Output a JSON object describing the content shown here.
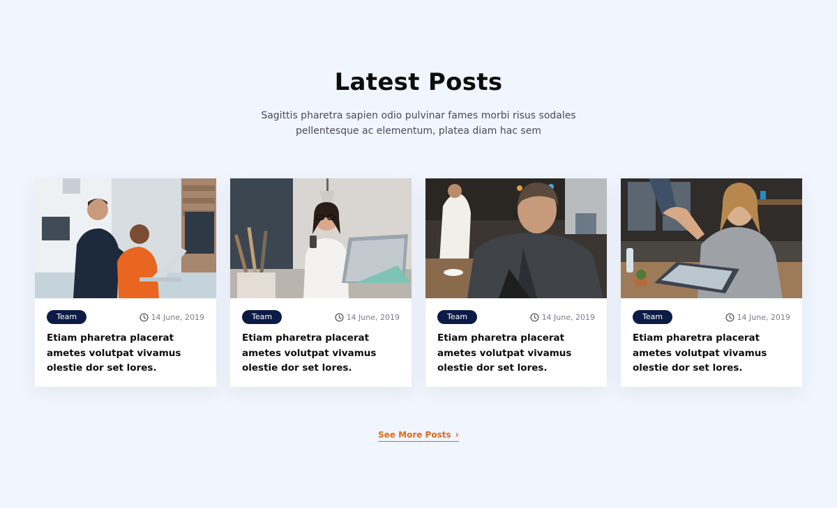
{
  "section": {
    "title": "Latest Posts",
    "subtitle": "Sagittis pharetra sapien odio pulvinar fames morbi risus sodales pellentesque ac elementum, platea diam hac sem"
  },
  "posts": [
    {
      "tag": "Team",
      "date": "14 June, 2019",
      "title": "Etiam pharetra placerat ametes volutpat vivamus olestie dor set lores.",
      "image": "office-colleagues-at-laptop-photo"
    },
    {
      "tag": "Team",
      "date": "14 June, 2019",
      "title": "Etiam pharetra placerat ametes volutpat vivamus olestie dor set lores.",
      "image": "woman-with-phone-at-desk-photo"
    },
    {
      "tag": "Team",
      "date": "14 June, 2019",
      "title": "Etiam pharetra placerat ametes volutpat vivamus olestie dor set lores.",
      "image": "meeting-presentation-photo"
    },
    {
      "tag": "Team",
      "date": "14 June, 2019",
      "title": "Etiam pharetra placerat ametes volutpat vivamus olestie dor set lores.",
      "image": "handshake-woman-smiling-photo"
    }
  ],
  "footer": {
    "more_label": "See More Posts",
    "more_icon": "chevron-right-icon"
  },
  "colors": {
    "background": "#f1f5fd",
    "tag_bg": "#0b1b45",
    "accent": "#e06a1c"
  }
}
